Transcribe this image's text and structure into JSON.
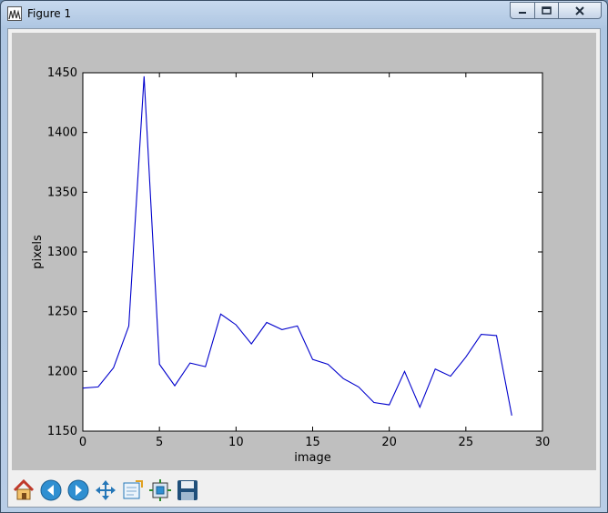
{
  "window": {
    "title": "Figure 1"
  },
  "toolbar": {
    "buttons": [
      {
        "name": "home-button",
        "icon": "home-icon"
      },
      {
        "name": "back-button",
        "icon": "back-arrow-icon"
      },
      {
        "name": "forward-button",
        "icon": "forward-arrow-icon"
      },
      {
        "name": "pan-button",
        "icon": "move-icon"
      },
      {
        "name": "zoom-button",
        "icon": "zoom-rect-icon"
      },
      {
        "name": "subplots-button",
        "icon": "subplots-icon"
      },
      {
        "name": "save-button",
        "icon": "floppy-disk-icon"
      }
    ]
  },
  "chart_data": {
    "type": "line",
    "xlabel": "image",
    "ylabel": "pixels",
    "xlim": [
      0,
      30
    ],
    "ylim": [
      1150,
      1450
    ],
    "xticks": [
      0,
      5,
      10,
      15,
      20,
      25,
      30
    ],
    "yticks": [
      1150,
      1200,
      1250,
      1300,
      1350,
      1400,
      1450
    ],
    "grid": false,
    "line_color": "#0000cc",
    "x": [
      0,
      1,
      2,
      3,
      4,
      5,
      6,
      7,
      8,
      9,
      10,
      11,
      12,
      13,
      14,
      15,
      16,
      17,
      18,
      19,
      20,
      21,
      22,
      23,
      24,
      25,
      26,
      27,
      28
    ],
    "y": [
      1186,
      1187,
      1203,
      1238,
      1447,
      1206,
      1188,
      1207,
      1204,
      1248,
      1239,
      1223,
      1241,
      1235,
      1238,
      1210,
      1206,
      1194,
      1187,
      1174,
      1172,
      1200,
      1170,
      1202,
      1196,
      1212,
      1231,
      1230,
      1163
    ]
  }
}
